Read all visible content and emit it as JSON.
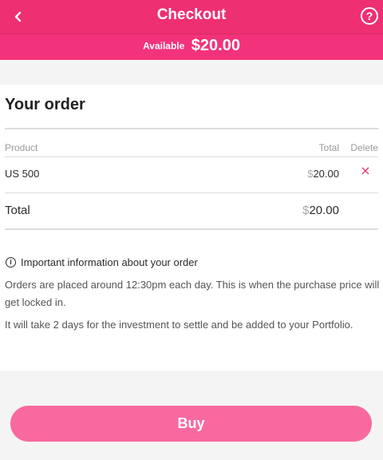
{
  "header": {
    "title": "Checkout",
    "back_icon": "chevron-left-icon",
    "help_icon": "help-icon",
    "help_glyph": "?"
  },
  "balance": {
    "label": "Available",
    "amount": "$20.00"
  },
  "order": {
    "title": "Your order",
    "columns": {
      "product": "Product",
      "total": "Total",
      "delete": "Delete"
    },
    "rows": [
      {
        "product": "US 500",
        "currency": "$",
        "total": "20.00"
      }
    ],
    "total_label": "Total",
    "total_currency": "$",
    "total_value": "20.00",
    "delete_glyph": "×"
  },
  "info": {
    "icon_glyph": "i",
    "heading": "Important information about your order",
    "paragraphs": [
      "Orders are placed around 12:30pm each day. This is when the purchase price will get locked in.",
      "It will take 2 days for the investment to settle and be added to your Portfolio."
    ]
  },
  "actions": {
    "buy_label": "Buy"
  },
  "colors": {
    "brand": "#ee2f72",
    "button": "#f86a9f",
    "delete": "#e8346f"
  }
}
